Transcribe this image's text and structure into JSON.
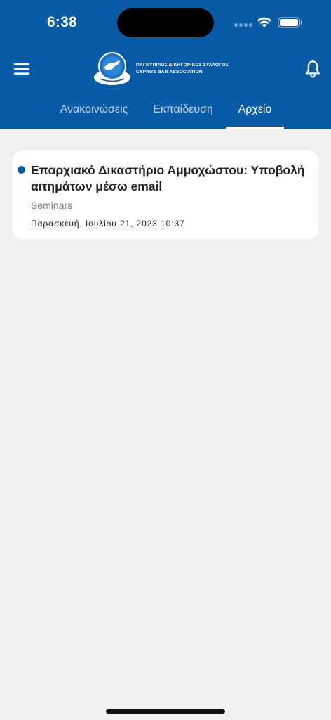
{
  "status_bar": {
    "time": "6:38"
  },
  "header": {
    "logo_line1": "ΠΑΓΚΥΠΡΙΟΣ ΔΙΚΗΓΟΡΙΚΟΣ ΣΥΛΛΟΓΟΣ",
    "logo_line2": "CYPRUS BAR ASSOCIATION",
    "brand_color": "#0a5ba6"
  },
  "tabs": [
    {
      "label": "Ανακοινώσεις",
      "active": false
    },
    {
      "label": "Εκπαίδευση",
      "active": false
    },
    {
      "label": "Αρχείο",
      "active": true
    }
  ],
  "items": [
    {
      "title": "Επαρχιακό Δικαστήριο Αμμοχώστου: Υποβολή αιτημάτων μέσω email",
      "category": "Seminars",
      "date": "Παρασκευή, Ιουλίου 21, 2023 10:37",
      "unread": true
    }
  ],
  "icons": {
    "menu": "menu-icon",
    "notifications": "bell-icon"
  }
}
